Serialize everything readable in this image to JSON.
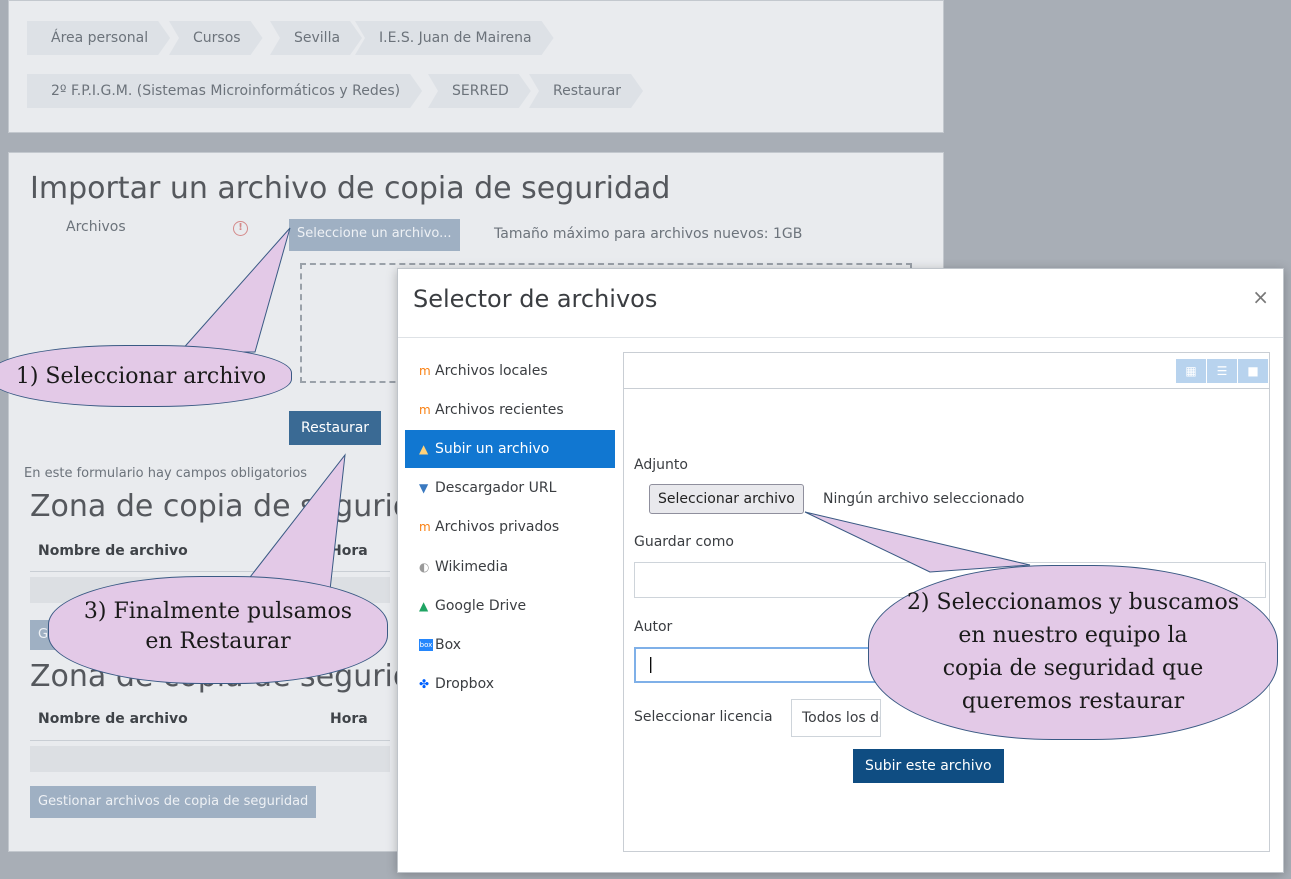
{
  "breadcrumb": {
    "row1": [
      "Área personal",
      "Cursos",
      "Sevilla",
      "I.E.S. Juan de Mairena"
    ],
    "row2": [
      "2º F.P.I.G.M. (Sistemas Microinformáticos y Redes)",
      "SERRED",
      "Restaurar"
    ]
  },
  "import": {
    "title": "Importar un archivo de copia de seguridad",
    "files_label": "Archivos",
    "required_icon": "!",
    "choose_button": "Seleccione un archivo...",
    "max_size": "Tamaño máximo para archivos nuevos: 1GB",
    "restore_button": "Restaurar",
    "required_note": "En este formulario hay campos obligatorios"
  },
  "zone1": {
    "title": "Zona de copia de seguridad",
    "col_name": "Nombre de archivo",
    "col_time": "Hora",
    "manage_button": "G"
  },
  "zone2": {
    "title": "Zona de copia de seguridad",
    "col_name": "Nombre de archivo",
    "col_time": "Hora",
    "manage_button": "Gestionar archivos de copia de seguridad"
  },
  "modal": {
    "title": "Selector de archivos",
    "close": "×",
    "repositories": [
      {
        "label": "Archivos locales",
        "icon": "moodle-icon",
        "glyph": "m",
        "active": false
      },
      {
        "label": "Archivos recientes",
        "icon": "moodle-icon",
        "glyph": "m",
        "active": false
      },
      {
        "label": "Subir un archivo",
        "icon": "upload-icon",
        "glyph": "▲",
        "active": true
      },
      {
        "label": "Descargador URL",
        "icon": "download-icon",
        "glyph": "▼",
        "active": false
      },
      {
        "label": "Archivos privados",
        "icon": "moodle-icon",
        "glyph": "m",
        "active": false
      },
      {
        "label": "Wikimedia",
        "icon": "wikimedia-icon",
        "glyph": "◐",
        "active": false
      },
      {
        "label": "Google Drive",
        "icon": "google-drive-icon",
        "glyph": "▲",
        "active": false
      },
      {
        "label": "Box",
        "icon": "box-icon",
        "glyph": "box",
        "active": false
      },
      {
        "label": "Dropbox",
        "icon": "dropbox-icon",
        "glyph": "✤",
        "active": false
      }
    ],
    "view_icons": [
      "grid-view-icon",
      "list-view-icon",
      "folder-view-icon"
    ],
    "attachment_label": "Adjunto",
    "select_file_button": "Seleccionar archivo",
    "no_file": "Ningún archivo seleccionado",
    "save_as_label": "Guardar como",
    "save_as_value": "",
    "author_label": "Autor",
    "author_value": "",
    "license_label": "Seleccionar licencia",
    "license_value": "Todos los derechos reservados",
    "upload_button": "Subir este archivo"
  },
  "callouts": {
    "step1": "1) Seleccionar archivo",
    "step2_lines": [
      "2) Seleccionamos y buscamos",
      "en nuestro equipo la",
      "copia de seguridad que",
      "queremos restaurar"
    ],
    "step3_lines": [
      "3) Finalmente pulsamos",
      "en Restaurar"
    ]
  },
  "colors": {
    "primary": "#0f4d82",
    "active_repo": "#1177d1",
    "callout_fill": "#e3c9e7",
    "callout_border": "#3a5a84",
    "required": "#d48a8a"
  }
}
